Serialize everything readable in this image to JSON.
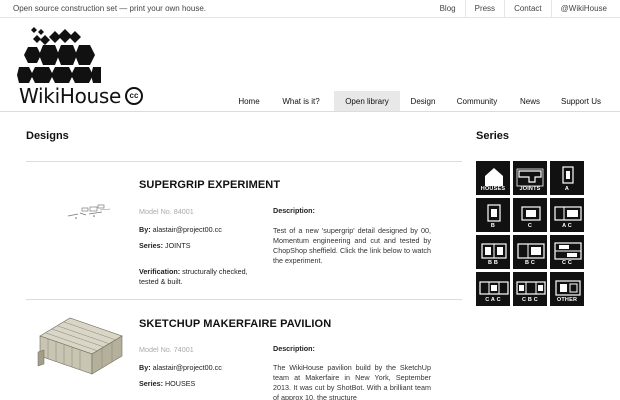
{
  "topbar": {
    "tagline": "Open source construction set — print your own house.",
    "links": [
      "Blog",
      "Press",
      "Contact",
      "@WikiHouse"
    ]
  },
  "logo": {
    "wordmark": "WikiHouse",
    "badge": "cc"
  },
  "nav": {
    "items": [
      "Home",
      "What is it?",
      "Open library",
      "Design",
      "Community",
      "News",
      "Support Us"
    ],
    "active": "Open library"
  },
  "designs_heading": "Designs",
  "series_heading": "Series",
  "labels": {
    "by": "By:",
    "series": "Series:",
    "verification": "Verification:",
    "description": "Description:"
  },
  "designs": [
    {
      "title": "SUPERGRIP EXPERIMENT",
      "model": "Model No. 84001",
      "by": "alastair@project00.cc",
      "series": "JOINTS",
      "verification": "structurally checked, tested & built.",
      "description": "Test of a new 'supergrip' detail designed by 00, Momentum engineering and cut and tested by ChopShop sheffield. Click the link below to watch the experiment."
    },
    {
      "title": "SKETCHUP MAKERFAIRE PAVILION",
      "model": "Model No. 74001",
      "by": "alastair@project00.cc",
      "series": "HOUSES",
      "description": "The WikiHouse pavilion build by the SketchUp team at Makerfaire in New York, September 2013. It was cut by ShotBot. With a brilliant team of approx 10, the structure"
    }
  ],
  "series_tiles": [
    "HOUSES",
    "JOINTS",
    "A",
    "B",
    "C",
    "A C",
    "B B",
    "B C",
    "C C",
    "C A C",
    "C B C",
    "OTHER"
  ],
  "colors": {
    "tile_bg": "#111111",
    "active_tab": "#e8e8e8",
    "muted_text": "#aaaaaa"
  }
}
